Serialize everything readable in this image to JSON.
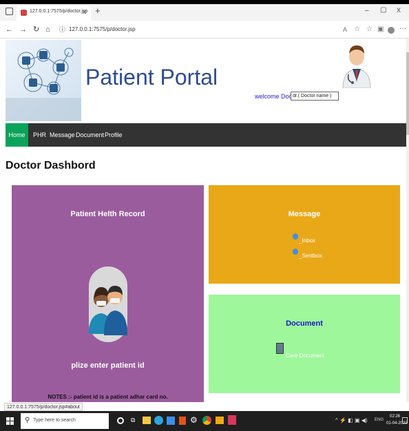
{
  "browser": {
    "tab_title": "127.0.0.1:7575/p/doctor.jsp",
    "tab_close": "x",
    "new_tab": "+",
    "address": "127.0.0.1:7575/p/doctor.jsp",
    "window_controls": {
      "minimize": "–",
      "maximize": "▢",
      "close": "X"
    },
    "status_url": "127.0.0.1:7575/p/doctor.jsp#about"
  },
  "header": {
    "title": "Patient Portal",
    "welcome_label": "welcome Doctor :-",
    "doctor_field": "dr.( Doctor name )"
  },
  "nav": {
    "items": [
      "Home",
      "PHR",
      "Message",
      "Document",
      "Profile"
    ]
  },
  "main": {
    "heading": "Doctor Dashbord"
  },
  "cards": {
    "phr": {
      "title": "Patient Helth Record",
      "prompt": "plize enter patient id",
      "note": "NOTES :- patient id is a patient adhar card no."
    },
    "message": {
      "title": "Message",
      "links": [
        "_Inbox",
        "_Sentbox"
      ]
    },
    "document": {
      "title": "Document",
      "link": "Care Document"
    }
  },
  "taskbar": {
    "search_placeholder": "Type here to search",
    "lang": "ENG",
    "time": "02:26",
    "date": "01-04-2022"
  },
  "colors": {
    "phr_card": "#9b5c9d",
    "message_card": "#e9a818",
    "document_card": "#9ef79a",
    "nav_bg": "#333333",
    "nav_active": "#0aa35b",
    "title_blue": "#2e4d8e"
  }
}
